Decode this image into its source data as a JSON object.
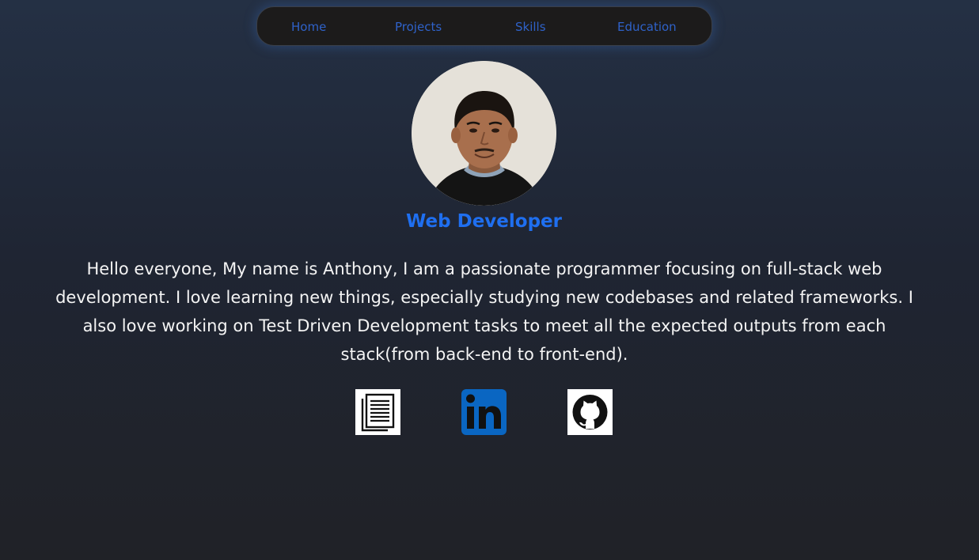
{
  "nav": {
    "items": [
      {
        "label": "Home"
      },
      {
        "label": "Projects"
      },
      {
        "label": "Skills"
      },
      {
        "label": "Education"
      }
    ]
  },
  "profile": {
    "avatar_icon": "profile-photo",
    "title": "Web Developer",
    "bio": "Hello everyone, My name is Anthony, I am a passionate programmer focusing on full-stack web development. I love learning new things, especially studying new codebases and related frameworks. I also love working on Test Driven Development tasks to meet all the expected outputs from each stack(from back-end to front-end)."
  },
  "social_links": [
    {
      "name": "resume",
      "icon": "document-icon"
    },
    {
      "name": "linkedin",
      "icon": "linkedin-icon",
      "color": "#0a66c2"
    },
    {
      "name": "github",
      "icon": "github-icon"
    }
  ],
  "colors": {
    "accent": "#1f6ff0",
    "nav_link": "#2f62c9",
    "nav_background": "#1c1b1b"
  }
}
